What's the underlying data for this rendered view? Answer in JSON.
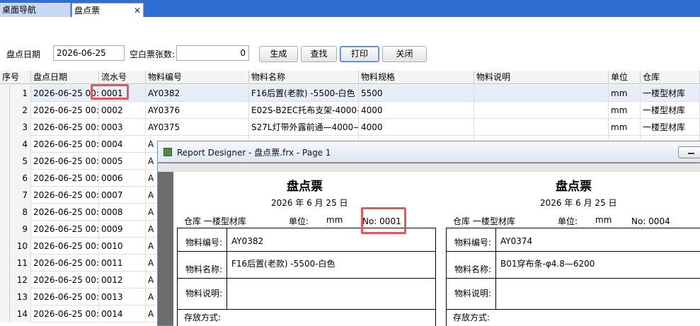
{
  "tabs": [
    {
      "label": "桌面导航"
    },
    {
      "label": "盘点票"
    }
  ],
  "tab_close_glyph": "✕",
  "toolbar": {
    "date_label": "盘点日期",
    "date_value": "2026-06-25",
    "blank_label": "空白票张数:",
    "blank_value": "0",
    "generate": "生成",
    "find": "查找",
    "print": "打印",
    "close": "关闭"
  },
  "grid": {
    "headers": [
      "序号",
      "盘点日期",
      "流水号",
      "物料编号",
      "物料名称",
      "物料规格",
      "物料说明",
      "单位",
      "仓库"
    ],
    "rows": [
      {
        "no": "1",
        "date": "2026-06-25 00:0",
        "serial": "0001",
        "code": "AY0382",
        "name": "F16后置(老款) -5500-白色",
        "spec": "5500",
        "desc": "",
        "unit": "mm",
        "wh": "一楼型材库"
      },
      {
        "no": "2",
        "date": "2026-06-25 00:0",
        "serial": "0002",
        "code": "AY0376",
        "name": "E02S-B2EC托布支架-4000-",
        "spec": "4000",
        "desc": "",
        "unit": "mm",
        "wh": "一楼型材库"
      },
      {
        "no": "3",
        "date": "2026-06-25 00:0",
        "serial": "0003",
        "code": "AY0375",
        "name": "S27L灯带外露前通—4000—",
        "spec": "4000",
        "desc": "",
        "unit": "mm",
        "wh": "一楼型材库"
      },
      {
        "no": "4",
        "date": "2026-06-25 00:0",
        "serial": "0004",
        "code": "A"
      },
      {
        "no": "5",
        "date": "2026-06-25 00:0",
        "serial": "0005",
        "code": "A"
      },
      {
        "no": "6",
        "date": "2026-06-25 00:0",
        "serial": "0006",
        "code": "A"
      },
      {
        "no": "7",
        "date": "2026-06-25 00:0",
        "serial": "0007",
        "code": "A"
      },
      {
        "no": "8",
        "date": "2026-06-25 00:0",
        "serial": "0008",
        "code": "A"
      },
      {
        "no": "9",
        "date": "2026-06-25 00:0",
        "serial": "0009",
        "code": "A"
      },
      {
        "no": "10",
        "date": "2026-06-25 00:0",
        "serial": "0010",
        "code": "A"
      },
      {
        "no": "11",
        "date": "2026-06-25 00:0",
        "serial": "0011",
        "code": "A"
      },
      {
        "no": "12",
        "date": "2026-06-25 00:0",
        "serial": "0012",
        "code": "A"
      },
      {
        "no": "13",
        "date": "2026-06-25 00:0",
        "serial": "0013",
        "code": "A"
      },
      {
        "no": "14",
        "date": "2026-06-25 00:0",
        "serial": "0014",
        "code": "A"
      }
    ]
  },
  "designer": {
    "title": "Report Designer - 盘点票.frx - Page 1",
    "tickets": [
      {
        "title": "盘点票",
        "date": "2026 年 6 月 25 日",
        "warehouse": "仓库  一楼型材库",
        "unit_label": "单位:",
        "unit_value": "mm",
        "no": "No: 0001",
        "code_label": "物料编号:",
        "code_value": "AY0382",
        "name_label": "物料名称:",
        "name_value": "F16后置(老款) -5500-白色",
        "desc_label": "物料说明:",
        "store_label": "存放方式:"
      },
      {
        "title": "盘点票",
        "date": "2026 年 6 月 25 日",
        "warehouse": "仓库  一楼型材库",
        "unit_label": "单位:",
        "unit_value": "mm",
        "no": "No: 0004",
        "code_label": "物料编号:",
        "code_value": "AY0374",
        "name_label": "物料名称:",
        "name_value": "B01穿布条-φ4.8—6200",
        "desc_label": "物料说明:",
        "store_label": "存放方式:"
      }
    ]
  },
  "colors": {
    "tabbar": "#2f6fd4",
    "highlight": "#e05a5a",
    "selected_row": "#e8eef8"
  }
}
